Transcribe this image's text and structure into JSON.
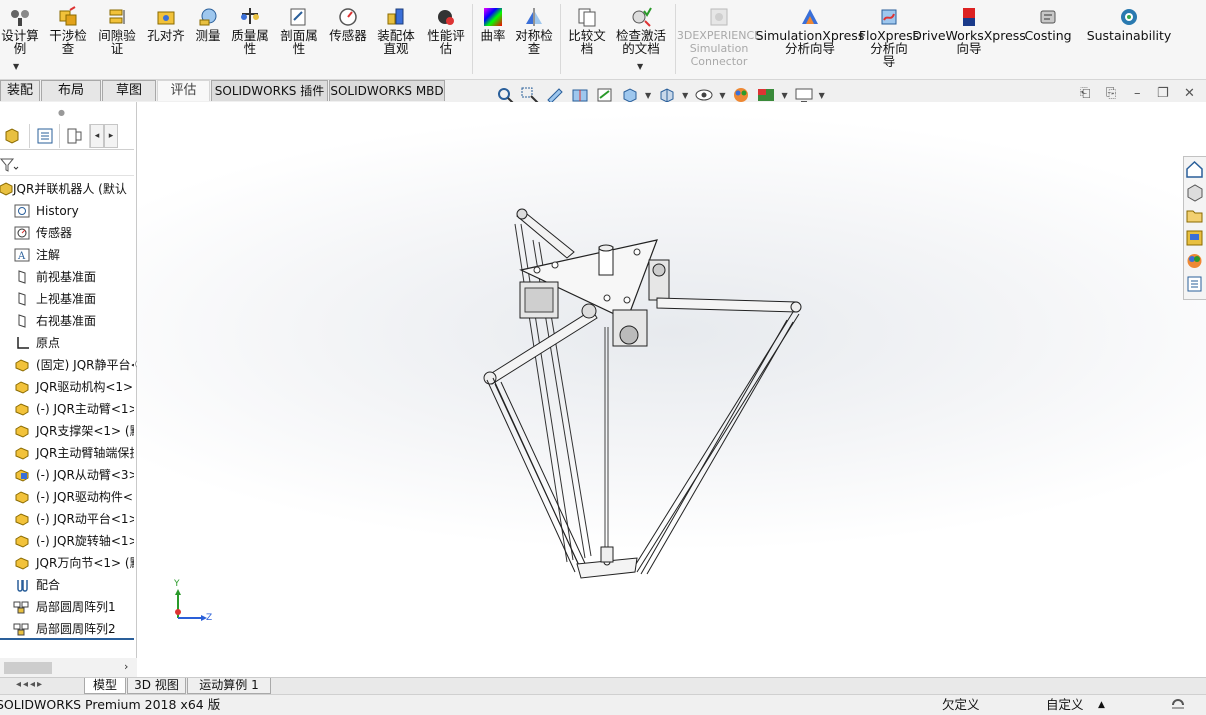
{
  "ribbon": {
    "buttons": [
      {
        "id": "design-study",
        "label": "设计算\n例"
      },
      {
        "id": "interference",
        "label": "干涉检\n查"
      },
      {
        "id": "clearance",
        "label": "间隙验\n证"
      },
      {
        "id": "hole-align",
        "label": "孔对齐"
      },
      {
        "id": "measure",
        "label": "测量"
      },
      {
        "id": "mass-props",
        "label": "质量属\n性"
      },
      {
        "id": "section-props",
        "label": "剖面属\n性"
      },
      {
        "id": "sensor",
        "label": "传感器"
      },
      {
        "id": "assembly-viz",
        "label": "装配体\n直观"
      },
      {
        "id": "performance",
        "label": "性能评\n估"
      },
      {
        "id": "curvature",
        "label": "曲率"
      },
      {
        "id": "symmetry",
        "label": "对称检\n查"
      },
      {
        "id": "compare",
        "label": "比较文\n档"
      },
      {
        "id": "check-active",
        "label": "检查激活\n的文档"
      },
      {
        "id": "3dx-sim",
        "label": "3DEXPERIENCE\nSimulation\nConnector"
      },
      {
        "id": "simxpress",
        "label": "SimulationXpress\n分析向导"
      },
      {
        "id": "floxpress",
        "label": "FloXpress\n分析向\n导"
      },
      {
        "id": "driveworks",
        "label": "DriveWorksXpress\n向导"
      },
      {
        "id": "costing",
        "label": "Costing"
      },
      {
        "id": "sustainability",
        "label": "Sustainability"
      }
    ]
  },
  "tabs": [
    {
      "id": "assembly",
      "label": "装配体"
    },
    {
      "id": "layout",
      "label": "布局"
    },
    {
      "id": "sketch",
      "label": "草图"
    },
    {
      "id": "evaluate",
      "label": "评估"
    },
    {
      "id": "addins",
      "label": "SOLIDWORKS 插件"
    },
    {
      "id": "mbd",
      "label": "SOLIDWORKS MBD"
    }
  ],
  "tree": {
    "items": [
      {
        "label": "JQR并联机器人 (默认"
      },
      {
        "label": "History"
      },
      {
        "label": "传感器"
      },
      {
        "label": "注解"
      },
      {
        "label": "前视基准面"
      },
      {
        "label": "上视基准面"
      },
      {
        "label": "右视基准面"
      },
      {
        "label": "原点"
      },
      {
        "label": "(固定) JQR静平台<"
      },
      {
        "label": "JQR驱动机构<1>"
      },
      {
        "label": "(-) JQR主动臂<1>"
      },
      {
        "label": "JQR支撑架<1> (默"
      },
      {
        "label": "JQR主动臂轴端保护"
      },
      {
        "label": "(-) JQR从动臂<3>"
      },
      {
        "label": "(-) JQR驱动构件<"
      },
      {
        "label": "(-) JQR动平台<1>"
      },
      {
        "label": "(-) JQR旋转轴<1>"
      },
      {
        "label": "JQR万向节<1> (默"
      },
      {
        "label": "配合"
      },
      {
        "label": "局部圆周阵列1"
      },
      {
        "label": "局部圆周阵列2"
      }
    ]
  },
  "bottom_tabs": [
    {
      "id": "model",
      "label": "模型"
    },
    {
      "id": "3dview",
      "label": "3D 视图"
    },
    {
      "id": "motion",
      "label": "运动算例 1"
    }
  ],
  "status": {
    "product": "SOLIDWORKS Premium 2018 x64 版",
    "state": "欠定义",
    "custom": "自定义"
  },
  "triad": {
    "y": "Y",
    "z": "Z"
  }
}
